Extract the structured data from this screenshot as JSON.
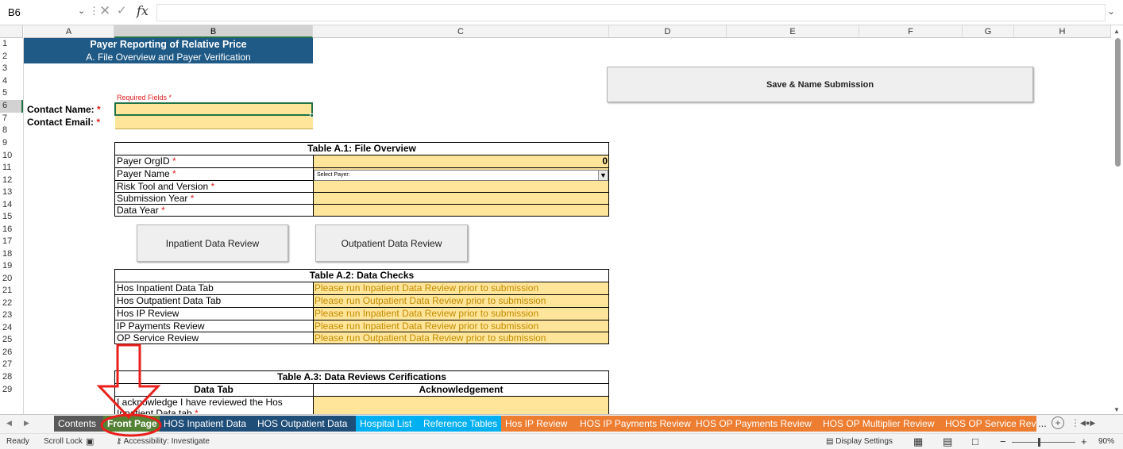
{
  "formula_bar": {
    "name_box": "B6",
    "fx": "fx",
    "formula": ""
  },
  "columns": [
    "A",
    "B",
    "C",
    "D",
    "E",
    "F",
    "G",
    "H"
  ],
  "rows": [
    "1",
    "2",
    "3",
    "4",
    "5",
    "6",
    "7",
    "8",
    "9",
    "10",
    "11",
    "12",
    "13",
    "14",
    "15",
    "16",
    "17",
    "18",
    "19",
    "20",
    "21",
    "22",
    "23",
    "24",
    "25",
    "26",
    "27",
    "28",
    "29"
  ],
  "header": {
    "title": "Payer Reporting of Relative Price",
    "subtitle": "A. File Overview and Payer Verification"
  },
  "required_fields_label": "Required Fields *",
  "contact": {
    "name_label": "Contact Name:",
    "email_label": "Contact Email:",
    "star": "*"
  },
  "table_a1": {
    "title": "Table A.1: File Overview",
    "rows": [
      {
        "label": "Payer OrgID",
        "required": "*",
        "value": "0"
      },
      {
        "label": "Payer Name",
        "required": "*",
        "value": ""
      },
      {
        "label": "Risk Tool and Version",
        "required": "*",
        "value": ""
      },
      {
        "label": "Submission Year",
        "required": "*",
        "value": ""
      },
      {
        "label": "Data Year",
        "required": "*",
        "value": ""
      }
    ],
    "select_placeholder": "Select Payer:"
  },
  "buttons": {
    "save": "Save & Name Submission",
    "inpatient_review": "Inpatient Data Review",
    "outpatient_review": "Outpatient Data Review"
  },
  "table_a2": {
    "title": "Table A.2: Data Checks",
    "rows": [
      {
        "label": "Hos Inpatient Data Tab",
        "status": "Please run Inpatient Data Review prior to submission"
      },
      {
        "label": "Hos Outpatient Data Tab",
        "status": "Please run Outpatient Data Review prior to submission"
      },
      {
        "label": "Hos IP Review",
        "status": "Please run Inpatient Data Review prior to submission"
      },
      {
        "label": "IP Payments Review",
        "status": "Please run Inpatient Data Review prior to submission"
      },
      {
        "label": "OP Service Review",
        "status": "Please run Outpatient Data Review prior to submission"
      }
    ]
  },
  "table_a3": {
    "title": "Table A.3: Data Reviews Cerifications",
    "col1": "Data Tab",
    "col2": "Acknowledgement",
    "row1_line1": "I acknowledge I have reviewed the Hos",
    "row1_line2": "Inpatient Data tab",
    "star": "*"
  },
  "sheet_tabs": [
    {
      "label": "Contents",
      "color": "#595959"
    },
    {
      "label": "Front Page",
      "color": "#548235"
    },
    {
      "label": "HOS Inpatient Data",
      "color": "#1f4e79"
    },
    {
      "label": "HOS Outpatient Data",
      "color": "#1f4e79"
    },
    {
      "label": "Hospital List",
      "color": "#00b0f0"
    },
    {
      "label": "Reference Tables",
      "color": "#00b0f0"
    },
    {
      "label": "Hos IP Review",
      "color": "#ed7d31"
    },
    {
      "label": "HOS IP Payments Review",
      "color": "#ed7d31"
    },
    {
      "label": "HOS OP Payments Review",
      "color": "#ed7d31"
    },
    {
      "label": "HOS OP Multiplier Review",
      "color": "#ed7d31"
    },
    {
      "label": "HOS OP Service Rev",
      "color": "#ed7d31"
    }
  ],
  "tab_more": "...",
  "tab_add": "+",
  "status_bar": {
    "ready": "Ready",
    "scroll_lock": "Scroll Lock",
    "accessibility": "Accessibility: Investigate",
    "display_settings": "Display Settings",
    "zoom_minus": "−",
    "zoom_plus": "+",
    "zoom": "90%"
  },
  "colors": {
    "header_blue": "#1f5a86",
    "field_yellow": "#ffe59a",
    "required_red": "#e02020",
    "status_text": "#c28a00",
    "annotation_red": "#e8201c",
    "selection_green": "#217346"
  }
}
